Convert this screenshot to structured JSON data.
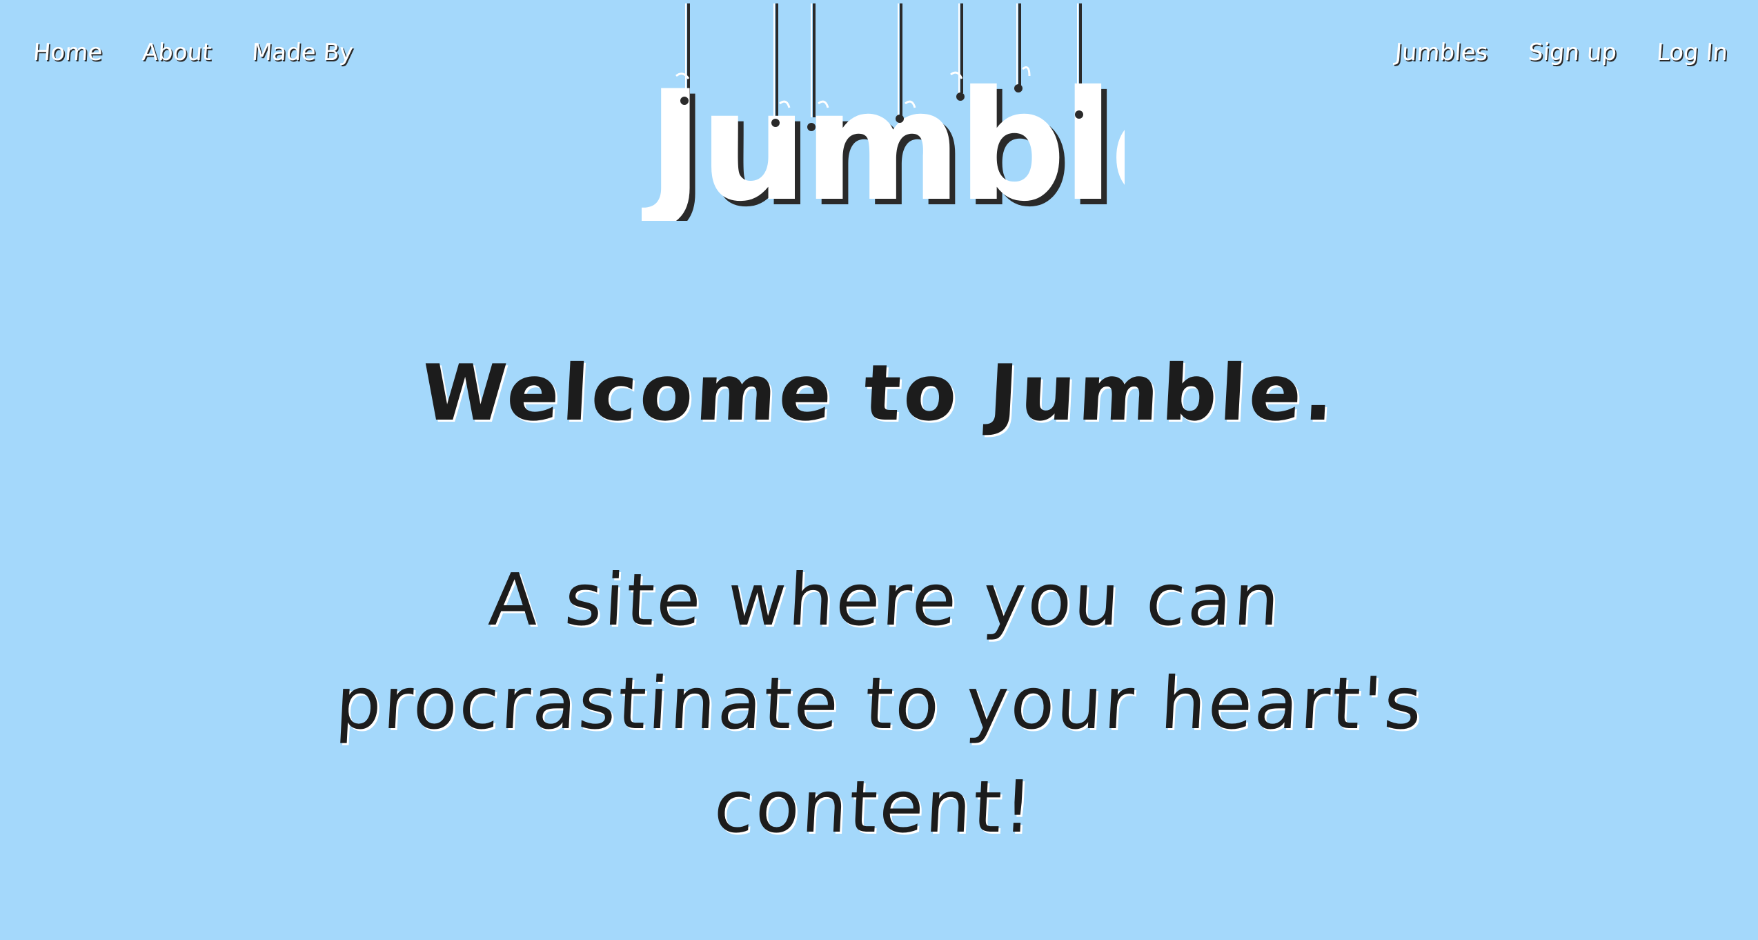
{
  "nav": {
    "left": [
      {
        "label": "Home"
      },
      {
        "label": "About"
      },
      {
        "label": "Made By"
      }
    ],
    "right": [
      {
        "label": "Jumbles"
      },
      {
        "label": "Sign up"
      },
      {
        "label": "Log In"
      }
    ]
  },
  "logo": {
    "text": "Jumble"
  },
  "main": {
    "welcome": "Welcome to Jumble.",
    "tagline": "A site where you can procrastinate to your heart's content!"
  },
  "colors": {
    "background": "#a4d8fb",
    "nav_text": "#ffffff",
    "body_text": "#1c1c1c"
  }
}
